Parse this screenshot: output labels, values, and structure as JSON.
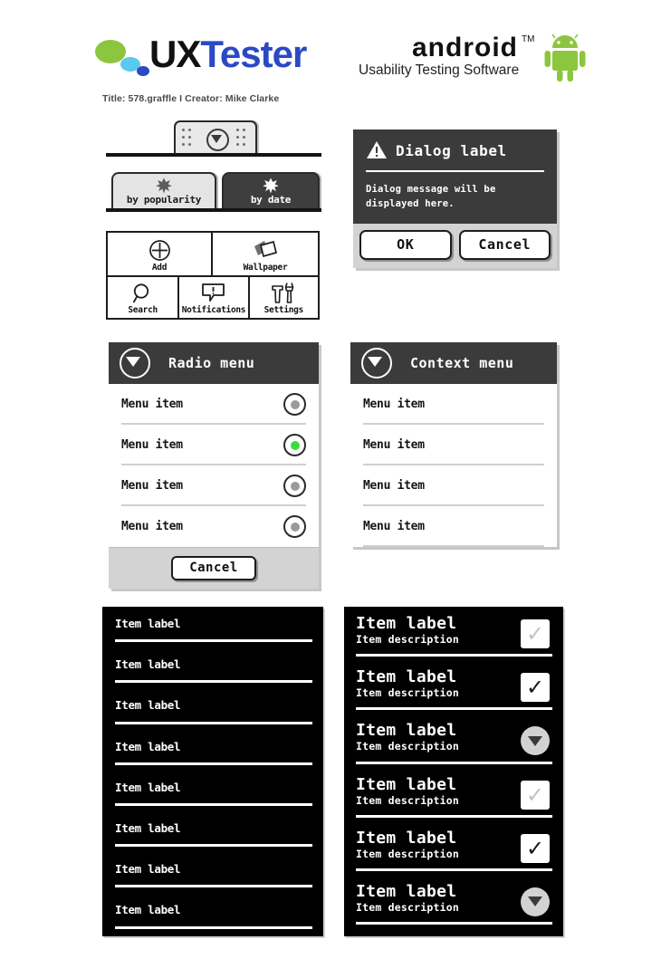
{
  "header": {
    "logo_ux": "UX",
    "logo_tester": "Tester",
    "meta": "Title: 578.graffle  I  Creator: Mike Clarke",
    "android_word": "android",
    "android_tm": "TM",
    "android_subtitle": "Usability Testing Software",
    "colors": {
      "dot_green": "#8cc63e",
      "dot_blue": "#5bc8f0",
      "dot_navy": "#2b49c4",
      "tester_blue": "#2b49c4",
      "robot_green": "#8cc63e"
    }
  },
  "tab_handle": {
    "name": "drag-handle",
    "icon": "circle-chevron-down-icon"
  },
  "tabs": [
    {
      "label": "by popularity",
      "selected": false,
      "icon": "star-icon"
    },
    {
      "label": "by date",
      "selected": true,
      "icon": "star-icon"
    }
  ],
  "options_menu": {
    "row1": [
      {
        "label": "Add",
        "icon": "plus-circle-icon"
      },
      {
        "label": "Wallpaper",
        "icon": "wallpaper-icon"
      }
    ],
    "row2": [
      {
        "label": "Search",
        "icon": "search-icon"
      },
      {
        "label": "Notifications",
        "icon": "notification-bubble-icon"
      },
      {
        "label": "Settings",
        "icon": "tools-icon"
      }
    ]
  },
  "dialog": {
    "icon": "warning-triangle-icon",
    "title": "Dialog label",
    "message": "Dialog message will be displayed here.",
    "ok_label": "OK",
    "cancel_label": "Cancel"
  },
  "radio_menu": {
    "title": "Radio menu",
    "header_icon": "circle-chevron-down-icon",
    "selected_color": "#3ddb3d",
    "unselected_color": "#9a9a9a",
    "items": [
      {
        "label": "Menu item",
        "selected": false
      },
      {
        "label": "Menu item",
        "selected": true
      },
      {
        "label": "Menu item",
        "selected": false
      },
      {
        "label": "Menu item",
        "selected": false
      }
    ],
    "cancel_label": "Cancel"
  },
  "context_menu": {
    "title": "Context menu",
    "header_icon": "circle-chevron-down-icon",
    "items": [
      {
        "label": "Menu item"
      },
      {
        "label": "Menu item"
      },
      {
        "label": "Menu item"
      },
      {
        "label": "Menu item"
      }
    ]
  },
  "simple_list": {
    "items": [
      {
        "label": "Item label"
      },
      {
        "label": "Item label"
      },
      {
        "label": "Item label"
      },
      {
        "label": "Item label"
      },
      {
        "label": "Item label"
      },
      {
        "label": "Item label"
      },
      {
        "label": "Item label"
      },
      {
        "label": "Item label"
      }
    ]
  },
  "detail_list": {
    "check_glyph": "✓",
    "items": [
      {
        "label": "Item label",
        "description": "Item description",
        "control": "checkbox-light",
        "checked": true
      },
      {
        "label": "Item label",
        "description": "Item description",
        "control": "checkbox-dark",
        "checked": true
      },
      {
        "label": "Item label",
        "description": "Item description",
        "control": "circle-chevron-down",
        "checked": false
      },
      {
        "label": "Item label",
        "description": "Item description",
        "control": "checkbox-light",
        "checked": true
      },
      {
        "label": "Item label",
        "description": "Item description",
        "control": "checkbox-dark",
        "checked": true
      },
      {
        "label": "Item label",
        "description": "Item description",
        "control": "circle-chevron-down",
        "checked": false
      }
    ]
  }
}
